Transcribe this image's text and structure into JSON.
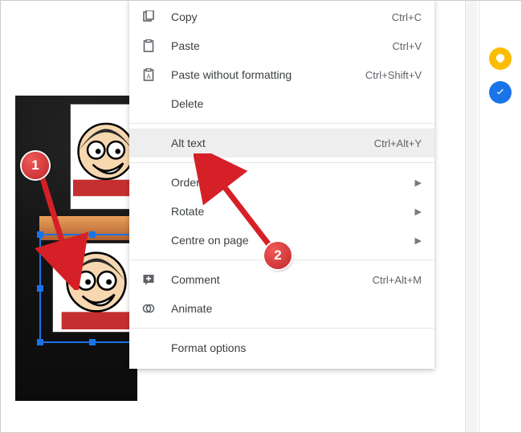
{
  "menu": {
    "copy": {
      "label": "Copy",
      "shortcut": "Ctrl+C"
    },
    "paste": {
      "label": "Paste",
      "shortcut": "Ctrl+V"
    },
    "pasteNF": {
      "label": "Paste without formatting",
      "shortcut": "Ctrl+Shift+V"
    },
    "delete": {
      "label": "Delete"
    },
    "alt": {
      "label": "Alt text",
      "shortcut": "Ctrl+Alt+Y"
    },
    "order": {
      "label": "Order"
    },
    "rotate": {
      "label": "Rotate"
    },
    "centre": {
      "label": "Centre on page"
    },
    "comment": {
      "label": "Comment",
      "shortcut": "Ctrl+Alt+M"
    },
    "animate": {
      "label": "Animate"
    },
    "format": {
      "label": "Format options"
    }
  },
  "annotations": {
    "badge1": "1",
    "badge2": "2"
  }
}
